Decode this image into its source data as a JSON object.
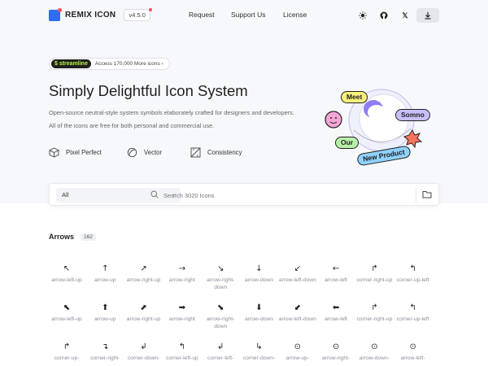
{
  "header": {
    "brand": "REMIX ICON",
    "version": "v4.5.0",
    "nav": [
      "Request",
      "Support Us",
      "License"
    ],
    "icons": [
      "sun-icon",
      "github-icon",
      "x-icon",
      "download-icon"
    ]
  },
  "promo": {
    "badge": "$ streamline",
    "text": "Access 170,000 More icons ›"
  },
  "hero": {
    "title": "Simply Delightful Icon System",
    "line1": "Open-source neutral-style system symbols elaborately crafted for designers and developers.",
    "line2": "All of the icons are free for both personal and commercial use.",
    "features": [
      "Pixel Perfect",
      "Vector",
      "Consistency"
    ],
    "tags": [
      "Meet",
      "Somno",
      "Our",
      "New Product"
    ]
  },
  "search": {
    "category": "All",
    "placeholder": "Search 3020 Icons"
  },
  "category": {
    "title": "Arrows",
    "count": "162"
  },
  "rows": [
    [
      {
        "g": "↖",
        "l": "arrow-left-up"
      },
      {
        "g": "↑",
        "l": "arrow-up"
      },
      {
        "g": "↗",
        "l": "arrow-right-up"
      },
      {
        "g": "→",
        "l": "arrow-right"
      },
      {
        "g": "↘",
        "l": "arrow-right-down"
      },
      {
        "g": "↓",
        "l": "arrow-down"
      },
      {
        "g": "↙",
        "l": "arrow-left-down"
      },
      {
        "g": "←",
        "l": "arrow-left"
      },
      {
        "g": "↱",
        "l": "corner-right-up"
      },
      {
        "g": "↰",
        "l": "corner-up-left"
      }
    ],
    [
      {
        "g": "⬉",
        "l": "arrow-left-up"
      },
      {
        "g": "⬆",
        "l": "arrow-up"
      },
      {
        "g": "⬈",
        "l": "arrow-right-up"
      },
      {
        "g": "➡",
        "l": "arrow-right"
      },
      {
        "g": "⬊",
        "l": "arrow-right-down"
      },
      {
        "g": "⬇",
        "l": "arrow-down"
      },
      {
        "g": "⬋",
        "l": "arrow-left-down"
      },
      {
        "g": "⬅",
        "l": "arrow-left"
      },
      {
        "g": "↱",
        "l": "corner-right-up"
      },
      {
        "g": "↰",
        "l": "corner-up-left"
      }
    ],
    [
      {
        "g": "↱",
        "l": "corner-up-"
      },
      {
        "g": "↴",
        "l": "corner-right-"
      },
      {
        "g": "↲",
        "l": "corner-down-"
      },
      {
        "g": "↰",
        "l": "corner-left-up"
      },
      {
        "g": "↲",
        "l": "corner-left-"
      },
      {
        "g": "↳",
        "l": "corner-down-"
      },
      {
        "g": "⊙",
        "l": "arrow-up-"
      },
      {
        "g": "⊙",
        "l": "arrow-right-"
      },
      {
        "g": "⊙",
        "l": "arrow-down-"
      },
      {
        "g": "⊙",
        "l": "arrow-left-"
      }
    ]
  ]
}
